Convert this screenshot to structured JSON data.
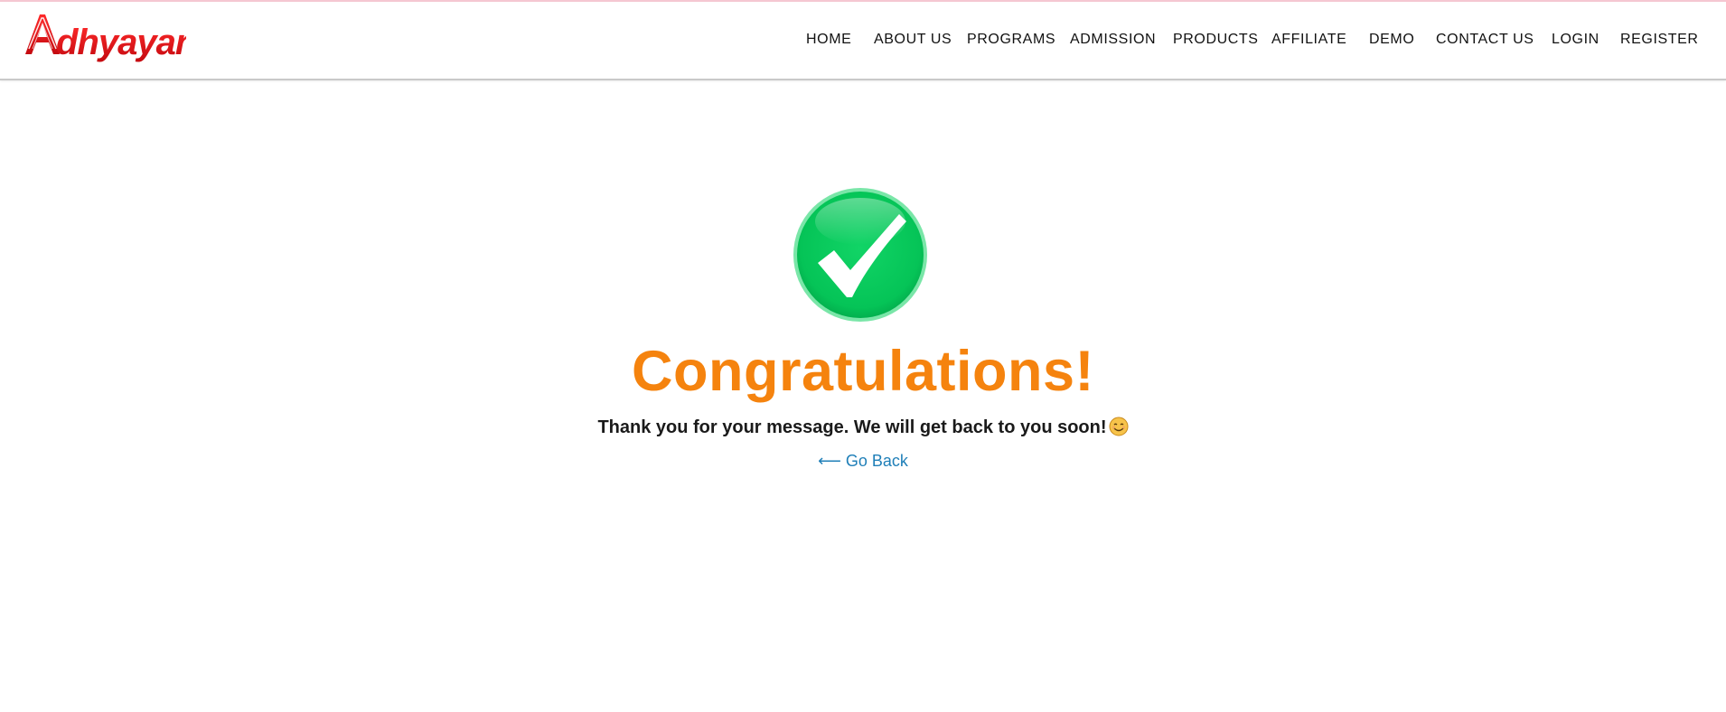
{
  "brand": {
    "logo_text": "Adhyayan",
    "logo_color": "#e0131a"
  },
  "nav": {
    "items": [
      {
        "label": "HOME"
      },
      {
        "label": "ABOUT US"
      },
      {
        "label": "PROGRAMS"
      },
      {
        "label": "ADMISSION"
      },
      {
        "label": "PRODUCTS"
      },
      {
        "label": "AFFILIATE"
      },
      {
        "label": "DEMO"
      },
      {
        "label": "CONTACT US"
      },
      {
        "label": "LOGIN"
      },
      {
        "label": "REGISTER"
      }
    ]
  },
  "main": {
    "status_icon": "check-circle-icon",
    "title": "Congratulations!",
    "message": "Thank you for your message. We will get back to you soon!",
    "emoji_icon": "smiling-face-icon",
    "back_arrow": "⟵",
    "back_label": "Go Back"
  },
  "colors": {
    "accent": "#f5830e",
    "success": "#0ac95a",
    "link": "#1f7fb8"
  }
}
